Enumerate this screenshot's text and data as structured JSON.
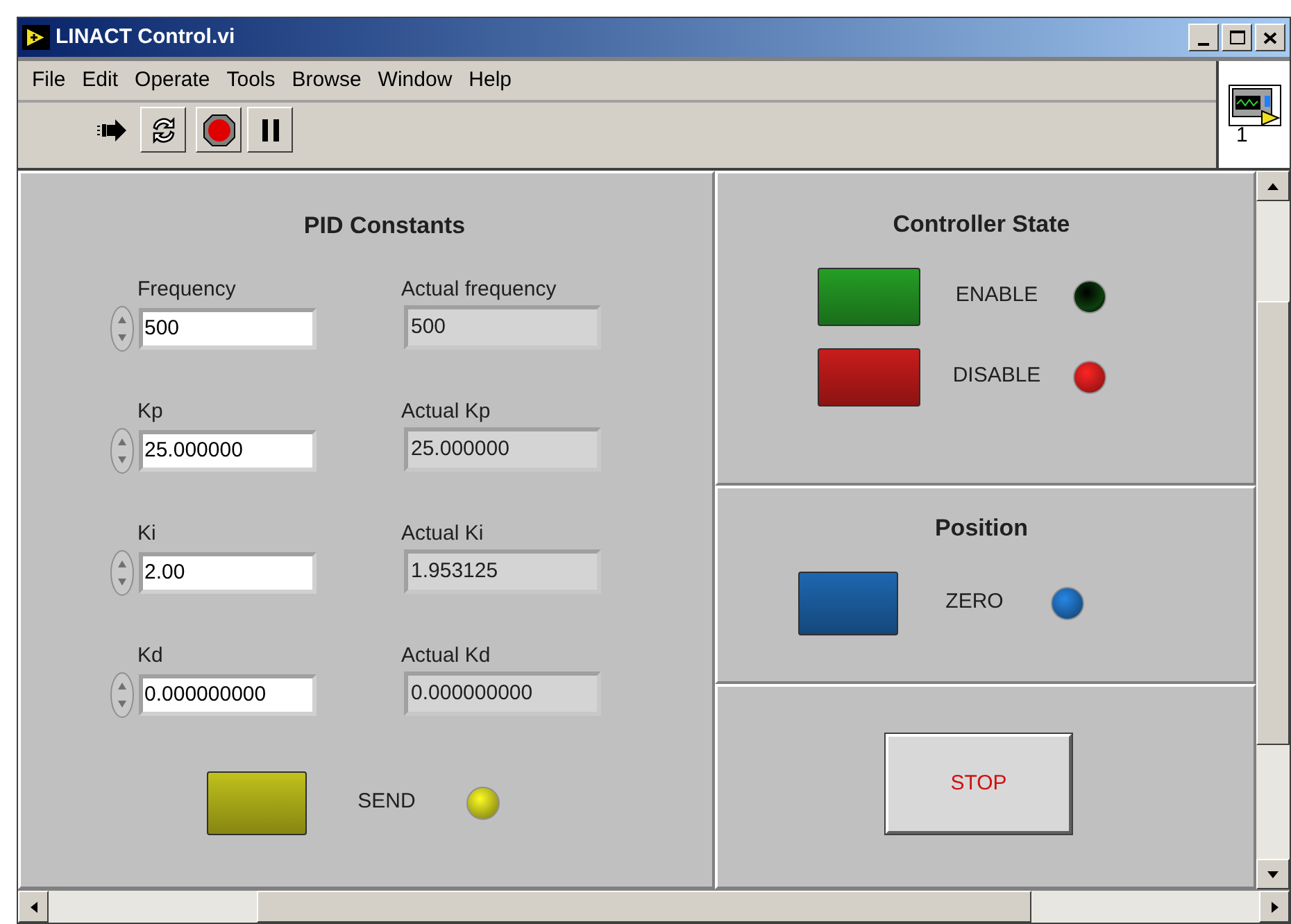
{
  "window": {
    "title": "LINACT Control.vi"
  },
  "menu": [
    "File",
    "Edit",
    "Operate",
    "Tools",
    "Browse",
    "Window",
    "Help"
  ],
  "connector_icon": {
    "label": "1"
  },
  "pid_constants": {
    "title": "PID Constants",
    "rows": [
      {
        "control_label": "Frequency",
        "control_value": "500",
        "indicator_label": "Actual frequency",
        "indicator_value": "500"
      },
      {
        "control_label": "Kp",
        "control_value": "25.000000",
        "indicator_label": "Actual Kp",
        "indicator_value": "25.000000"
      },
      {
        "control_label": "Ki",
        "control_value": "2.00",
        "indicator_label": "Actual Ki",
        "indicator_value": "1.953125"
      },
      {
        "control_label": "Kd",
        "control_value": "0.000000000",
        "indicator_label": "Actual Kd",
        "indicator_value": "0.000000000"
      }
    ],
    "actions": [
      {
        "label": "SEND",
        "color": "#a8a818",
        "on": true
      }
    ]
  },
  "controller_state": {
    "title": "Controller State",
    "actions": [
      {
        "label": "ENABLE",
        "color": "#208a20",
        "on": false
      },
      {
        "label": "DISABLE",
        "color": "#b01818",
        "on": true
      }
    ]
  },
  "position": {
    "title": "Position",
    "actions": [
      {
        "label": "ZERO",
        "color": "#1a5a9a",
        "on": true
      }
    ]
  },
  "stop_button": {
    "label": "STOP"
  }
}
